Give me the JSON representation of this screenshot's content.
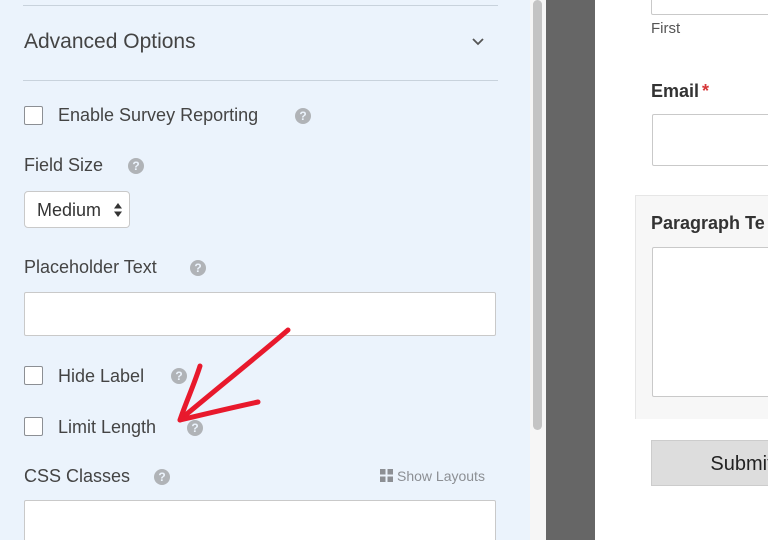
{
  "advanced_options": {
    "title": "Advanced Options",
    "enable_survey_reporting": {
      "label": "Enable Survey Reporting",
      "checked": false
    },
    "field_size": {
      "label": "Field Size",
      "value": "Medium"
    },
    "placeholder_text": {
      "label": "Placeholder Text",
      "value": ""
    },
    "hide_label": {
      "label": "Hide Label",
      "checked": false
    },
    "limit_length": {
      "label": "Limit Length",
      "checked": false
    },
    "css_classes": {
      "label": "CSS Classes",
      "value": ""
    },
    "show_layouts": {
      "label": "Show Layouts"
    },
    "help_glyph": "?"
  },
  "preview": {
    "name_first_sublabel": "First",
    "email_label": "Email",
    "required_marker": "*",
    "paragraph_label": "Paragraph Te",
    "submit_label": "Submit"
  },
  "colors": {
    "panel_background": "#ebf3fc",
    "gutter": "#666666",
    "required": "#d63638",
    "annotation_arrow": "#e8192c"
  },
  "icons": {
    "chevron": "chevron-down-icon",
    "help": "question-circle-icon",
    "layouts": "grid-icon",
    "select_arrows": "up-down-arrows-icon",
    "annotation": "hand-drawn-arrow-icon"
  }
}
